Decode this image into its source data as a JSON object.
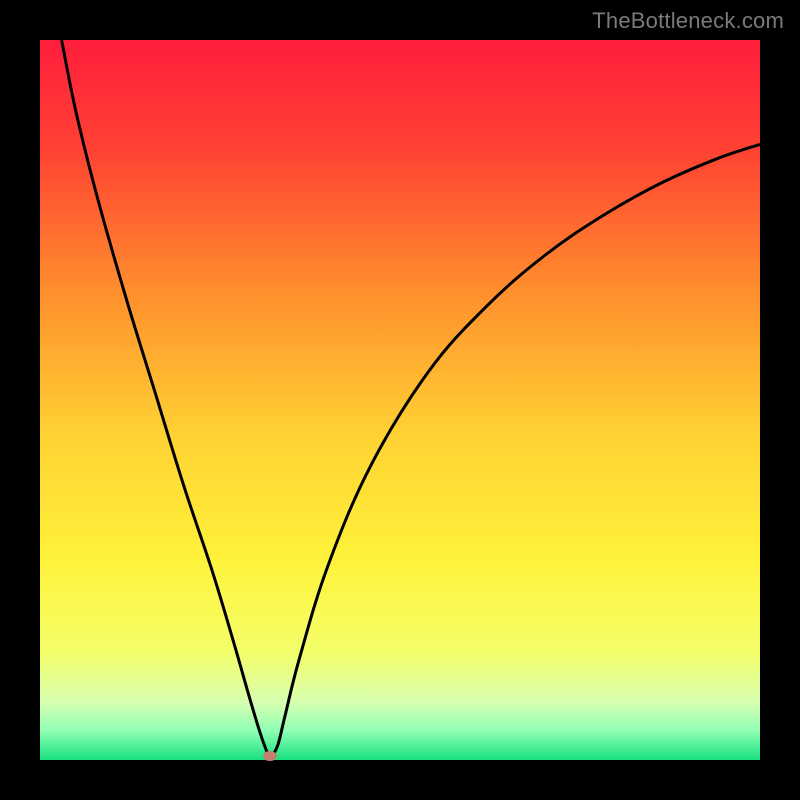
{
  "attribution": "TheBottleneck.com",
  "colors": {
    "bg": "#000000",
    "attribution": "#7a7a7a",
    "curve": "#000000",
    "marker": "#c4806e",
    "gradient_stops": [
      {
        "pct": 0,
        "color": "#ff1e3c"
      },
      {
        "pct": 15,
        "color": "#ff4133"
      },
      {
        "pct": 35,
        "color": "#ff8f2d"
      },
      {
        "pct": 55,
        "color": "#ffd233"
      },
      {
        "pct": 72,
        "color": "#fff23a"
      },
      {
        "pct": 85,
        "color": "#f4ff6a"
      },
      {
        "pct": 92,
        "color": "#d7ffb0"
      },
      {
        "pct": 96,
        "color": "#8dffb4"
      },
      {
        "pct": 100,
        "color": "#18e07f"
      }
    ]
  },
  "chart_data": {
    "type": "line",
    "title": "",
    "xlabel": "",
    "ylabel": "",
    "xlim": [
      0,
      100
    ],
    "ylim": [
      0,
      100
    ],
    "series": [
      {
        "name": "bottleneck-curve",
        "x": [
          3,
          5,
          8,
          12,
          16,
          20,
          24,
          27,
          29,
          30.5,
          31.5,
          32,
          33,
          34,
          36,
          40,
          46,
          54,
          62,
          70,
          78,
          86,
          94,
          100
        ],
        "y": [
          100,
          90,
          78,
          64,
          51,
          38,
          26,
          16,
          9,
          4,
          1.2,
          0.5,
          2,
          6,
          14,
          27,
          41,
          54,
          63,
          70,
          75.5,
          80,
          83.5,
          85.5
        ]
      }
    ],
    "marker": {
      "x": 32,
      "y": 0.5
    }
  }
}
